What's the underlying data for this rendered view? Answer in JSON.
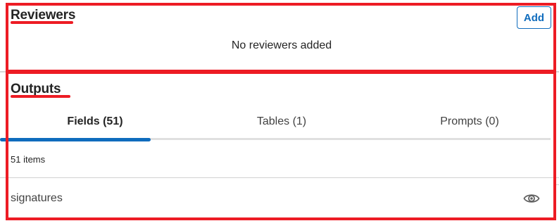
{
  "reviewers": {
    "title": "Reviewers",
    "add_label": "Add",
    "empty_message": "No reviewers added"
  },
  "outputs": {
    "title": "Outputs",
    "tabs": [
      {
        "label": "Fields (51)",
        "active": true
      },
      {
        "label": "Tables (1)",
        "active": false
      },
      {
        "label": "Prompts (0)",
        "active": false
      }
    ],
    "item_count": "51 items",
    "rows": [
      {
        "label": "signatures",
        "icon": "eye-icon"
      }
    ]
  },
  "colors": {
    "annotation": "#ed1c24",
    "accent": "#0f6cbd"
  }
}
